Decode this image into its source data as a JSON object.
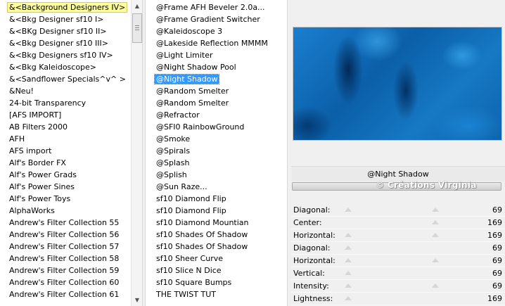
{
  "categories": [
    "&<Background Designers IV>",
    "&<Bkg Designer sf10 I>",
    "&<BKg Designer sf10 II>",
    "&<Bkg Designer sf10 III>",
    "&<Bkg Designers sf10 IV>",
    "&<Bkg Kaleidoscope>",
    "&<Sandflower Specials^v^ >",
    "&Neu!",
    "24-bit Transparency",
    "[AFS IMPORT]",
    "AB Filters 2000",
    "AFH",
    "AFS import",
    "Alf's Border FX",
    "Alf's Power Grads",
    "Alf's Power Sines",
    "Alf's Power Toys",
    "AlphaWorks",
    "Andrew's Filter Collection 55",
    "Andrew's Filter Collection 56",
    "Andrew's Filter Collection 57",
    "Andrew's Filter Collection 58",
    "Andrew's Filter Collection 59",
    "Andrew's Filter Collection 60",
    "Andrew's Filter Collection 61"
  ],
  "filters": [
    "@Frame AFH Beveler 2.0a...",
    "@Frame Gradient Switcher",
    "@Kaleidoscope 3",
    "@Lakeside Reflection MMMM",
    "@Light Limiter",
    "@Night Shadow Pool",
    "@Night Shadow",
    "@Random Smelter",
    "@Random Smelter",
    "@Refractor",
    "@SFI0 RainbowGround",
    "@Smoke",
    "@Spirals",
    "@Splash",
    "@Splish",
    "@Sun Raze...",
    "sf10 Diamond Flip",
    "sf10 Diamond Flip",
    "sf10 Diamond Mountian",
    "sf10 Shades Of Shadow",
    "sf10 Shades Of Shadow",
    "sf10 Sheer Curve",
    "sf10 Slice N Dice",
    "sf10 Square Bumps",
    "THE TWIST TUT"
  ],
  "selected_category_index": 0,
  "selected_filter_index": 6,
  "preview": {
    "filter_name": "@Night Shadow",
    "watermark": "© Créations Virginia"
  },
  "parameters": [
    {
      "name": "Diagonal:",
      "value": "69"
    },
    {
      "name": "Center:",
      "value": "169"
    },
    {
      "name": "Horizontal:",
      "value": "169"
    },
    {
      "name": "Diagonal:",
      "value": "69"
    },
    {
      "name": "Horizontal:",
      "value": "69"
    },
    {
      "name": "Vertical:",
      "value": "69"
    },
    {
      "name": "Intensity:",
      "value": "69"
    },
    {
      "name": "Lightness:",
      "value": "169"
    }
  ],
  "colors": {
    "category_highlight": "#ffff99",
    "filter_selection": "#3399ff",
    "preview_base": "#0b5fa8"
  }
}
